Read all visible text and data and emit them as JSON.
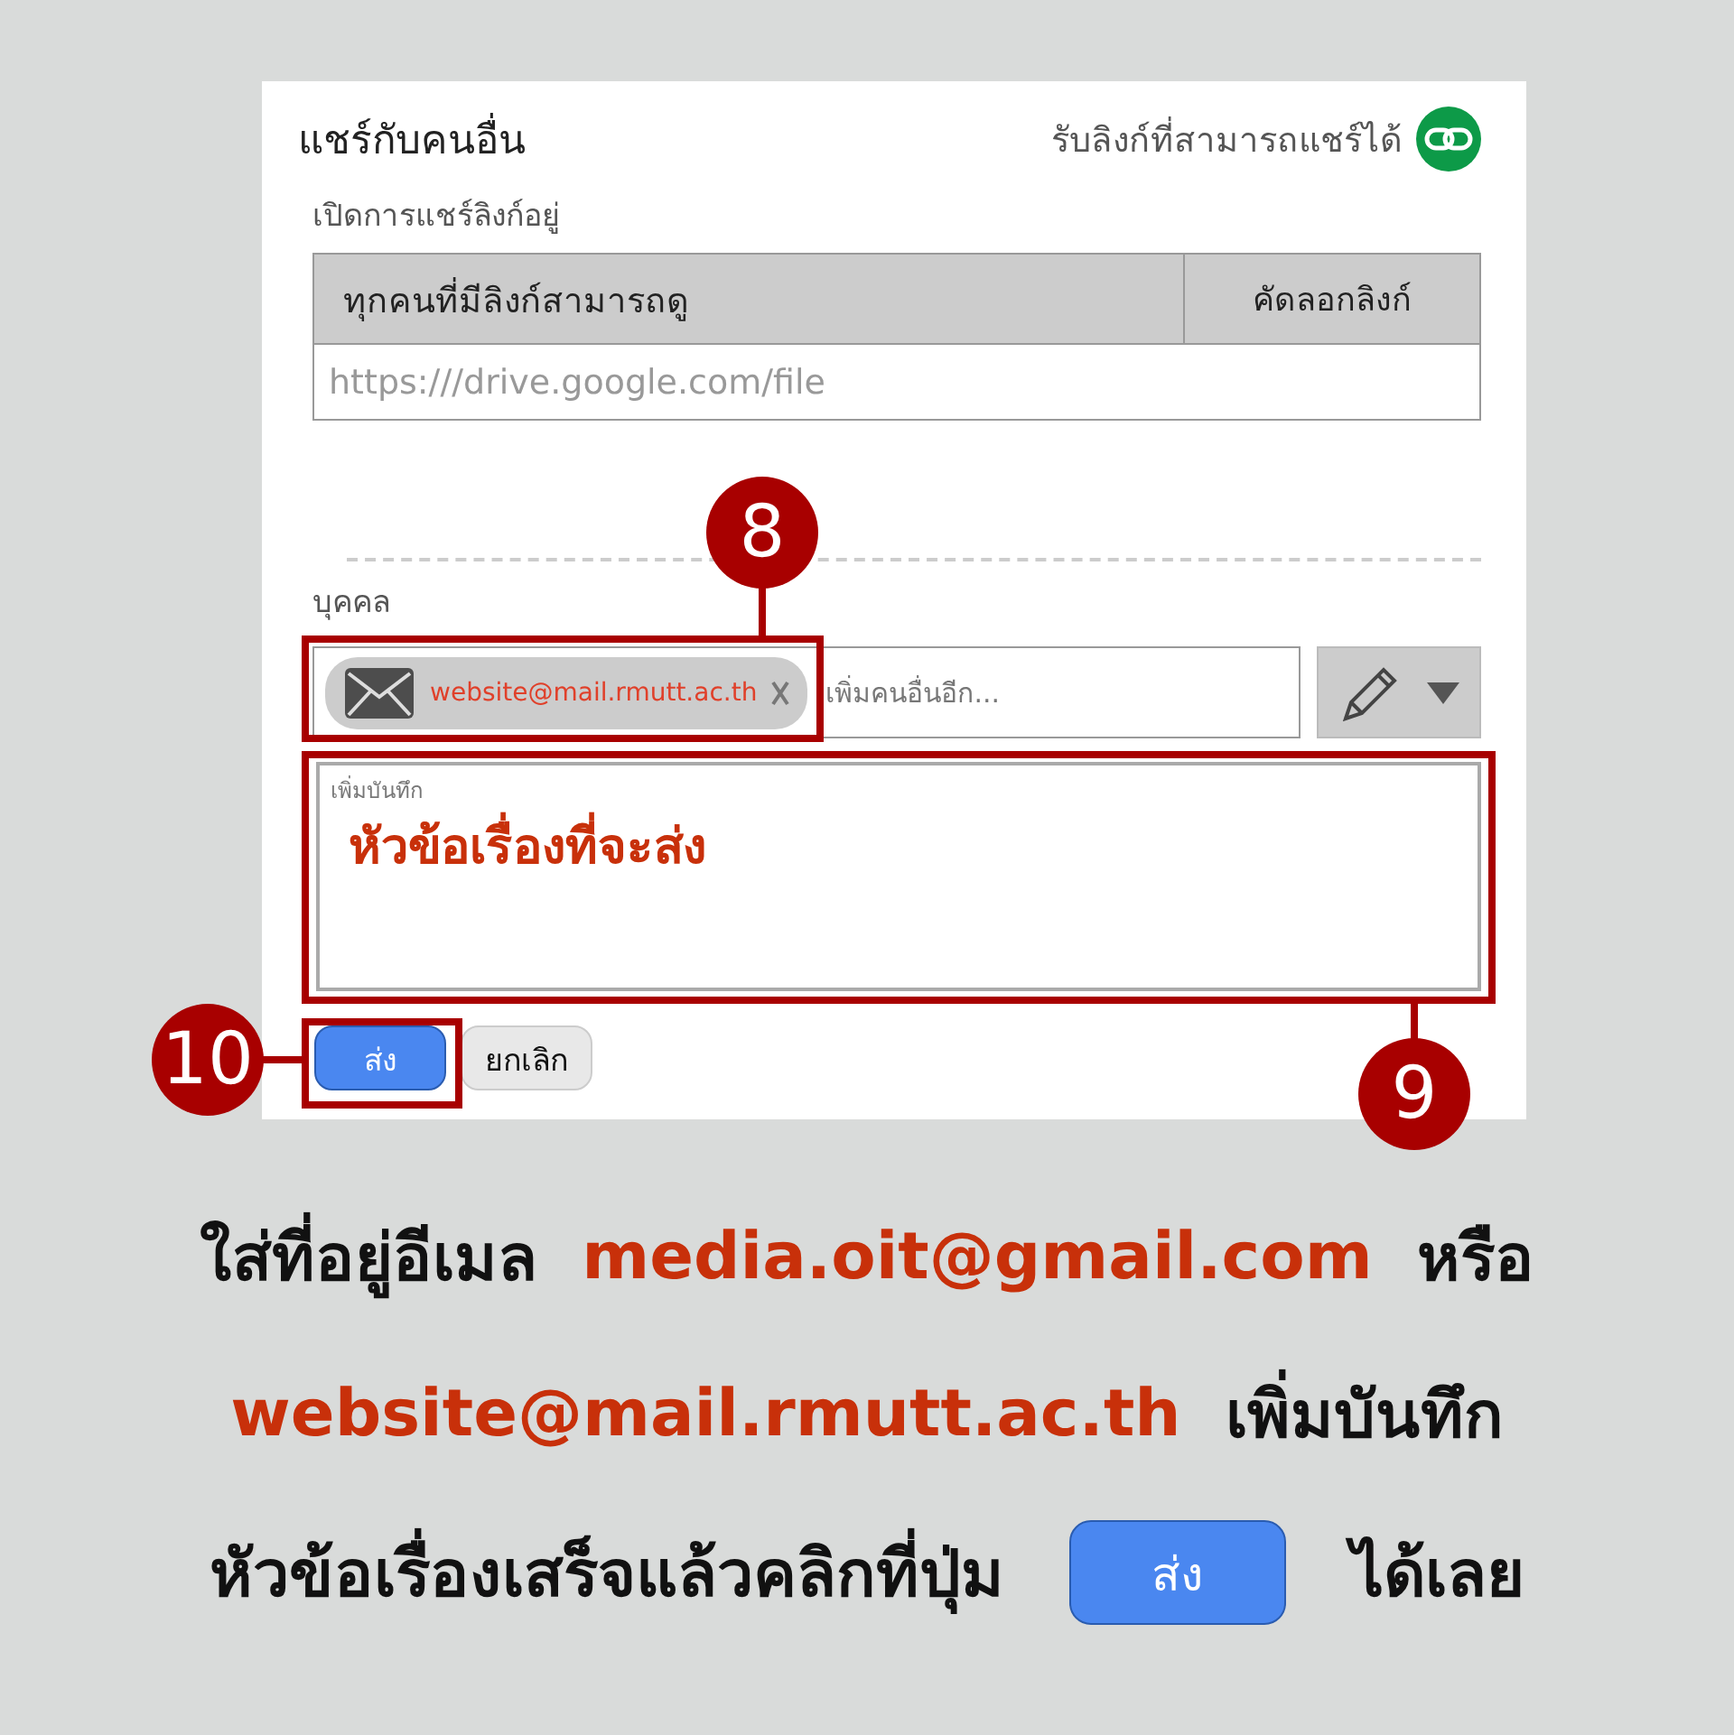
{
  "dialog": {
    "title": "แชร์กับคนอื่น",
    "get_link": "รับลิงก์ที่สามารถแชร์ได้",
    "link_status": "เปิดการแชร์ลิงก์อยู่",
    "link_access": "ทุกคนที่มีลิงก์สามารถดู",
    "copy_link": "คัดลอกลิงก์",
    "link_url": "https:///drive.google.com/file",
    "people_label": "บุคคล",
    "recipient_chips": [
      {
        "email": "website@mail.rmutt.ac.th"
      }
    ],
    "add_people": {
      "placeholder": "เพิ่มคนอื่นอีก..."
    },
    "note": {
      "label": "เพิ่มบันทึก",
      "value": "หัวข้อเรื่องที่จะส่ง"
    },
    "buttons": [
      {
        "label": "ส่ง",
        "kind": "primary"
      },
      {
        "label": "ยกเลิก",
        "kind": "secondary"
      }
    ]
  },
  "callouts": [
    {
      "label": "8",
      "kind": "recipient"
    },
    {
      "label": "9",
      "kind": "note"
    },
    {
      "label": "10",
      "kind": "send"
    }
  ],
  "instructions": [
    {
      "segments": [
        {
          "text": "ใส่ที่อยู่อีเมล ",
          "kind": "plain"
        },
        {
          "text": "media.oit@gmail.com",
          "kind": "email"
        },
        {
          "text": " หรือ",
          "kind": "plain"
        }
      ]
    },
    {
      "segments": [
        {
          "text": "website@mail.rmutt.ac.th",
          "kind": "email"
        },
        {
          "text": " เพิ่มบันทึก",
          "kind": "plain"
        }
      ]
    },
    {
      "segments": [
        {
          "text": "หัวข้อเรื่องเสร็จแล้วคลิกที่ปุ่ม",
          "kind": "plain"
        },
        {
          "text": "ส่ง",
          "kind": "button"
        },
        {
          "text": "ได้เลย",
          "kind": "plain"
        }
      ]
    }
  ]
}
